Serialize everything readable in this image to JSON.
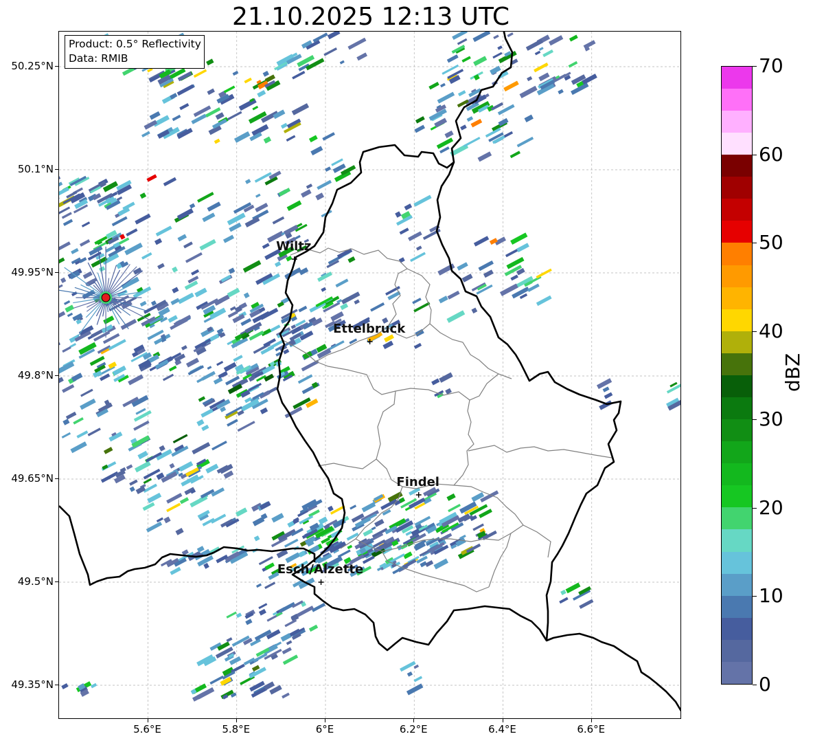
{
  "title": "21.10.2025 12:13 UTC",
  "info": {
    "product": "Product: 0.5° Reflectivity",
    "data_source": "Data: RMIB"
  },
  "map": {
    "lon_range": [
      5.4,
      6.8
    ],
    "lat_range": [
      49.3,
      50.3
    ],
    "lat_ticks": [
      {
        "value": 50.25,
        "label": "50.25°N"
      },
      {
        "value": 50.1,
        "label": "50.1°N"
      },
      {
        "value": 49.95,
        "label": "49.95°N"
      },
      {
        "value": 49.8,
        "label": "49.8°N"
      },
      {
        "value": 49.65,
        "label": "49.65°N"
      },
      {
        "value": 49.5,
        "label": "49.5°N"
      },
      {
        "value": 49.35,
        "label": "49.35°N"
      }
    ],
    "lon_ticks": [
      {
        "value": 5.6,
        "label": "5.6°E"
      },
      {
        "value": 5.8,
        "label": "5.8°E"
      },
      {
        "value": 6.0,
        "label": "6°E"
      },
      {
        "value": 6.2,
        "label": "6.2°E"
      },
      {
        "value": 6.4,
        "label": "6.4°E"
      },
      {
        "value": 6.6,
        "label": "6.6°E"
      }
    ],
    "cities": [
      {
        "name": "Wiltz",
        "lon": 5.93,
        "lat": 49.97
      },
      {
        "name": "Ettelbruck",
        "lon": 6.1,
        "lat": 49.85
      },
      {
        "name": "Findel",
        "lon": 6.21,
        "lat": 49.627
      },
      {
        "name": "Esch/Alzette",
        "lon": 5.99,
        "lat": 49.5
      }
    ],
    "radar_site": {
      "lon": 5.505,
      "lat": 49.914
    },
    "colors": {
      "border": "#000000",
      "admin": "#808080",
      "grid": "#b0b0b0",
      "radar_site": "#e31a1c"
    }
  },
  "colorbar": {
    "label": "dBZ",
    "min": 0,
    "max": 70,
    "ticks": [
      {
        "value": 0,
        "label": "0"
      },
      {
        "value": 10,
        "label": "10"
      },
      {
        "value": 20,
        "label": "20"
      },
      {
        "value": 30,
        "label": "30"
      },
      {
        "value": 40,
        "label": "40"
      },
      {
        "value": 50,
        "label": "50"
      },
      {
        "value": 60,
        "label": "60"
      },
      {
        "value": 70,
        "label": "70"
      }
    ],
    "colors": [
      "#6473a8",
      "#55689f",
      "#465d9e",
      "#4a79b0",
      "#5a9ec8",
      "#66c3db",
      "#66d8c4",
      "#42d46f",
      "#16c722",
      "#13b81e",
      "#12a61a",
      "#118e14",
      "#0b7a0f",
      "#085f09",
      "#47730b",
      "#b0b00a",
      "#ffd700",
      "#ffb400",
      "#ff9a00",
      "#ff7f00",
      "#e60000",
      "#c40000",
      "#a00000",
      "#7a0000",
      "#ffe0ff",
      "#ffb0ff",
      "#ff70f8",
      "#ec38ec"
    ]
  }
}
